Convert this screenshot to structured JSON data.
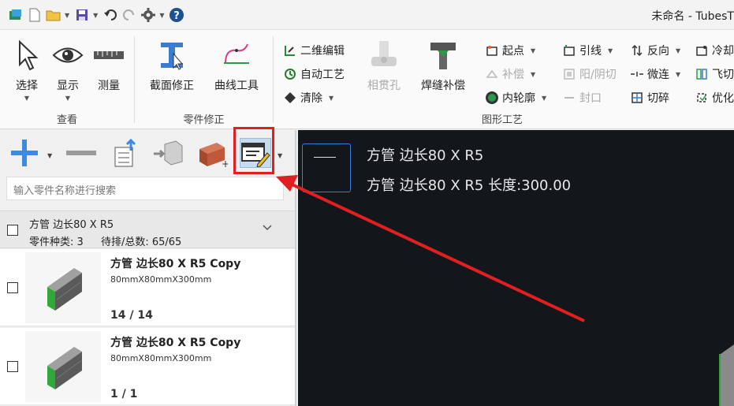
{
  "window": {
    "title": "未命名 - TubesT"
  },
  "ribbon": {
    "view_group": {
      "label": "查看",
      "select": "选择",
      "display": "显示",
      "measure": "测量"
    },
    "part_group": {
      "label": "零件修正",
      "section_fix": "截面修正",
      "curve_tool": "曲线工具"
    },
    "graphic_group": {
      "label": "图形工艺",
      "edit2d": "二维编辑",
      "auto_process": "自动工艺",
      "clear": "清除",
      "intersect_hole": "相贯孔",
      "weld_comp": "焊缝补偿",
      "start_point": "起点",
      "compensate": "补偿",
      "inner_contour": "内轮廓",
      "lead_line": "引线",
      "yin_yang_cut": "阳/阴切",
      "seal": "封口",
      "reverse": "反向",
      "micro_joint": "微连",
      "shatter": "切碎",
      "cooling": "冷却",
      "fly_cut": "飞切",
      "optimize": "优化"
    }
  },
  "parts_panel": {
    "search_placeholder": "输入零件名称进行搜索",
    "group": {
      "title": "方管 边长80 X R5",
      "kinds_label": "零件种类: 3",
      "pending_label": "待排/总数: 65/65"
    },
    "items": [
      {
        "name": "方管 边长80 X R5 Copy",
        "dims": "80mmX80mmX300mm",
        "count": "14 / 14"
      },
      {
        "name": "方管 边长80 X R5 Copy",
        "dims": "80mmX80mmX300mm",
        "count": "1 / 1"
      }
    ]
  },
  "canvas": {
    "line1": "方管 边长80 X R5",
    "line2": "方管 边长80 X R5 长度:300.00"
  },
  "colors": {
    "highlight": "#e02020",
    "canvas_bg": "#13171c",
    "accent": "#3a7fd4"
  }
}
